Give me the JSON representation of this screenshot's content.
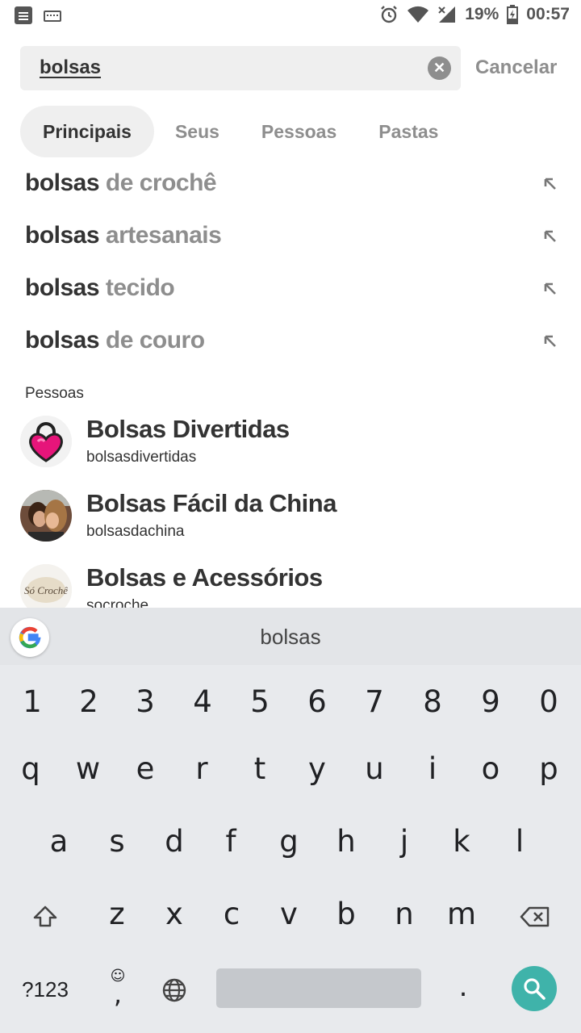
{
  "status_bar": {
    "battery": "19%",
    "time": "00:57"
  },
  "search": {
    "query": "bolsas",
    "cancel_label": "Cancelar"
  },
  "tabs": [
    {
      "label": "Principais",
      "active": true
    },
    {
      "label": "Seus"
    },
    {
      "label": "Pessoas"
    },
    {
      "label": "Pastas"
    }
  ],
  "suggestions": [
    {
      "bold": "bolsas",
      "rest": " de crochê"
    },
    {
      "bold": "bolsas",
      "rest": " artesanais"
    },
    {
      "bold": "bolsas",
      "rest": " tecido"
    },
    {
      "bold": "bolsas",
      "rest": " de couro"
    }
  ],
  "people_section_label": "Pessoas",
  "people": [
    {
      "name": "Bolsas Divertidas",
      "handle": "bolsasdivertidas",
      "avatar": "pink-heart-bag"
    },
    {
      "name": "Bolsas Fácil da China",
      "handle": "bolsasdachina",
      "avatar": "photo-couple"
    },
    {
      "name": "Bolsas e Acessórios",
      "handle": "socroche",
      "avatar": "so-croche-logo",
      "avatar_text": "Só Crochê"
    }
  ],
  "keyboard": {
    "suggestion": "bolsas",
    "row_numbers": [
      "1",
      "2",
      "3",
      "4",
      "5",
      "6",
      "7",
      "8",
      "9",
      "0"
    ],
    "row_1": [
      "q",
      "w",
      "e",
      "r",
      "t",
      "y",
      "u",
      "i",
      "o",
      "p"
    ],
    "row_2": [
      "a",
      "s",
      "d",
      "f",
      "g",
      "h",
      "j",
      "k",
      "l"
    ],
    "row_3": [
      "z",
      "x",
      "c",
      "v",
      "b",
      "n",
      "m"
    ],
    "symbols_label": "?123",
    "comma": ",",
    "period": "."
  },
  "colors": {
    "accent": "#3fb3aa",
    "muted_text": "#8e8e8e",
    "pill_bg": "#efefef"
  }
}
